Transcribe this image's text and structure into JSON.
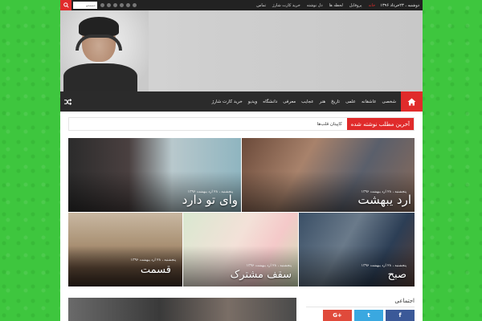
{
  "topbar": {
    "search_placeholder": "جستجو",
    "date": "دوشنبه ، ۲۳خرداد ۱۳۹۶",
    "menu": [
      "خانه",
      "پروفایل",
      "لحظه ها",
      "دل نوشته",
      "خرید کارت شارژ",
      "تماس"
    ]
  },
  "nav": {
    "items": [
      "شخصی",
      "عاشقانه",
      "علمی",
      "تاریخ",
      "هنر",
      "عجایب",
      "معرفی",
      "دانشگاه",
      "ویدیو",
      "خرید کارت شارژ"
    ]
  },
  "ticker": {
    "label": "آخرین مطلب نوشته شده",
    "text": "کاپیتان قلب‌ها"
  },
  "tiles": [
    {
      "title": "ارد یبهشت",
      "date": "پنجشنبه ، ۲۸ ارد یبهشت ۱۳۹۶"
    },
    {
      "title": "وای تو دارد",
      "date": "پنجشنبه ، ۲۸ ارد یبهشت ۱۳۹۶"
    },
    {
      "title": "صبح",
      "date": "پنجشنبه ، ۲۸ ارد یبهشت ۱۳۹۶"
    },
    {
      "title": "سقف مشترک",
      "date": "پنجشنبه ، ۲۸ ارد یبهشت ۱۳۹۶"
    },
    {
      "title": "قسمت",
      "date": "پنجشنبه ، ۲۸ ارد یبهشت ۱۳۹۶"
    }
  ],
  "sidebar": {
    "widget_title": "اجتماعی",
    "social": [
      "G+",
      "t",
      "f"
    ]
  },
  "colors": {
    "accent": "#e02b2b",
    "background": "#3ec63e",
    "nav": "#2b2b2b"
  }
}
